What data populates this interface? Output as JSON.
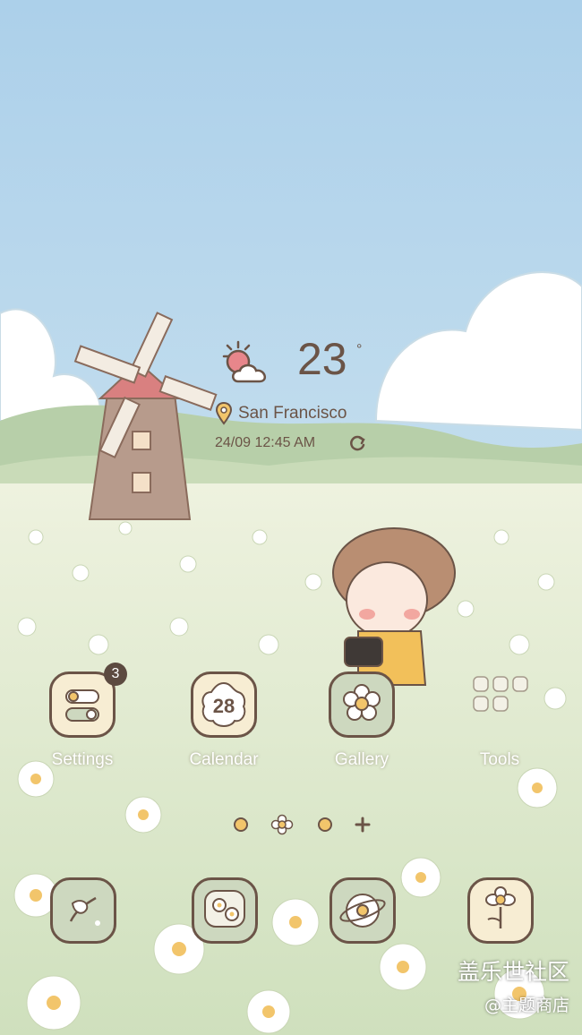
{
  "weather": {
    "temperature": "23",
    "degree_symbol": "°",
    "city": "San Francisco",
    "datetime": "24/09 12:45 AM",
    "condition_icon": "partly-cloudy-icon",
    "refresh_icon": "refresh-icon"
  },
  "apps": [
    {
      "label": "Settings",
      "icon": "settings-toggle-icon",
      "badge": "3"
    },
    {
      "label": "Calendar",
      "icon": "calendar-icon",
      "day": "28"
    },
    {
      "label": "Gallery",
      "icon": "flower-gallery-icon"
    },
    {
      "label": "Tools",
      "icon": "tools-folder-icon"
    }
  ],
  "dock": [
    {
      "icon": "phone-flower-icon"
    },
    {
      "icon": "messages-flower-icon"
    },
    {
      "icon": "browser-flower-icon"
    },
    {
      "icon": "camera-flower-icon"
    }
  ],
  "page_indicator": {
    "pages": 3,
    "current": 1
  },
  "watermark": {
    "line1": "盖乐世社区",
    "line2": "@主题商店"
  },
  "colors": {
    "sky": "#b9d8ec",
    "tile": "#f7edd3",
    "tile_green": "#cdd8bf",
    "ink": "#6b5447"
  }
}
